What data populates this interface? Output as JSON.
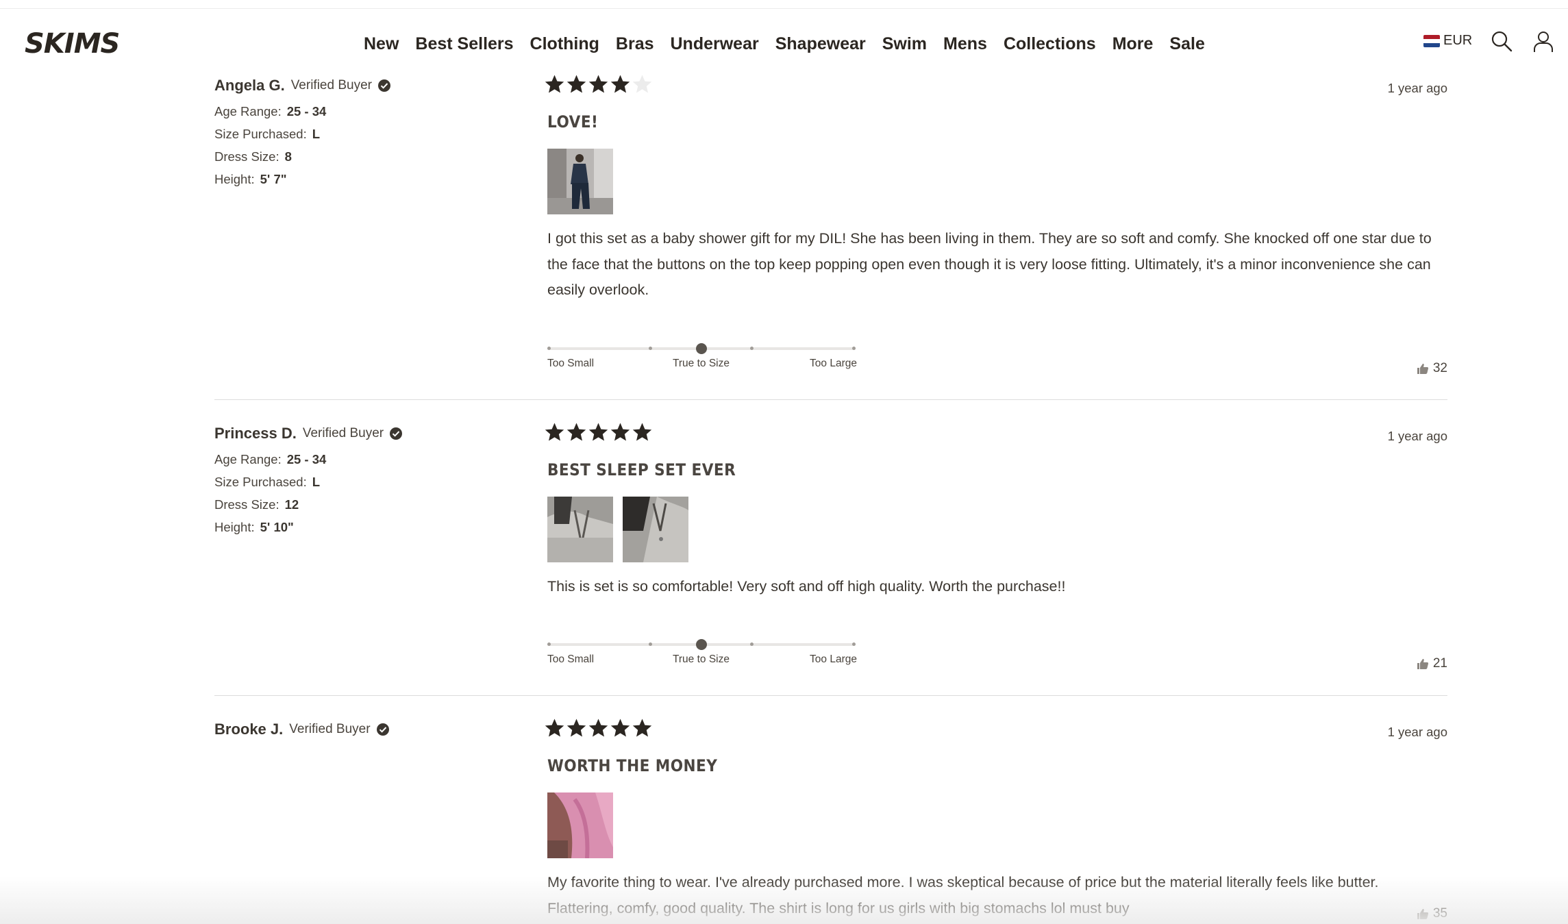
{
  "header": {
    "logo_text": "SKIMS",
    "nav": [
      "New",
      "Best Sellers",
      "Clothing",
      "Bras",
      "Underwear",
      "Shapewear",
      "Swim",
      "Mens",
      "Collections",
      "More",
      "Sale"
    ],
    "currency": "EUR",
    "icons": [
      "search-icon",
      "account-icon"
    ]
  },
  "fit_labels": {
    "small": "Too Small",
    "true": "True to Size",
    "large": "Too Large"
  },
  "reviews": [
    {
      "author": "Angela G.",
      "verified": "Verified Buyer",
      "rating": 4,
      "date": "1 year ago",
      "title": "LOVE!",
      "details": [
        {
          "label": "Age Range:",
          "value": "25 - 34"
        },
        {
          "label": "Size Purchased:",
          "value": "L"
        },
        {
          "label": "Dress Size:",
          "value": "8"
        },
        {
          "label": "Height:",
          "value": "5' 7\""
        }
      ],
      "photos": 1,
      "body": "I got this set as a baby shower gift for my DIL! She has been living in them. They are so soft and comfy. She knocked off one star due to the face that the buttons on the top keep popping open even though it is very loose fitting. Ultimately, it's a minor inconvenience she can easily overlook.",
      "fit_value": 0.5,
      "helpful": "32"
    },
    {
      "author": "Princess D.",
      "verified": "Verified Buyer",
      "rating": 5,
      "date": "1 year ago",
      "title": "BEST SLEEP SET EVER",
      "details": [
        {
          "label": "Age Range:",
          "value": "25 - 34"
        },
        {
          "label": "Size Purchased:",
          "value": "L"
        },
        {
          "label": "Dress Size:",
          "value": "12"
        },
        {
          "label": "Height:",
          "value": "5' 10\""
        }
      ],
      "photos": 2,
      "body": "This is set is so comfortable! Very soft and off high quality. Worth the purchase!!",
      "fit_value": 0.5,
      "helpful": "21"
    },
    {
      "author": "Brooke J.",
      "verified": "Verified Buyer",
      "rating": 5,
      "date": "1 year ago",
      "title": "WORTH THE MONEY",
      "details": [],
      "photos": 1,
      "body": "My favorite thing to wear. I've already purchased more. I was skeptical because of price but the material literally feels like butter. Flattering, comfy, good quality. The shirt is long for us girls with big stomachs lol must buy",
      "helpful": "35"
    }
  ]
}
